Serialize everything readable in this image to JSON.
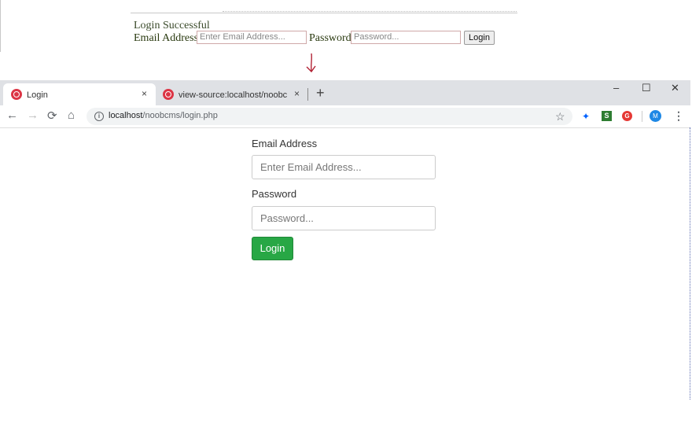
{
  "snippet": {
    "title": "Login Successful",
    "email_label": "Email Address",
    "email_placeholder": "Enter Email Address...",
    "password_label": "Password",
    "password_placeholder": "Password...",
    "login_label": "Login"
  },
  "browser": {
    "tabs": [
      {
        "title": "Login",
        "close": "×"
      },
      {
        "title": "view-source:localhost/noobcms/",
        "close": "×"
      }
    ],
    "new_tab": "+",
    "window_controls": {
      "minimize": "–",
      "maximize": "☐",
      "close": "✕"
    },
    "nav": {
      "back": "←",
      "forward": "→",
      "reload": "⟳",
      "home": "⌂"
    },
    "url_host": "localhost",
    "url_path": "/noobcms/login.php",
    "star": "☆",
    "extensions": {
      "dropbox": "✦",
      "s": "S",
      "g": "G"
    },
    "avatar": "M",
    "menu": "⋮"
  },
  "page": {
    "email_label": "Email Address",
    "email_placeholder": "Enter Email Address...",
    "password_label": "Password",
    "password_placeholder": "Password...",
    "login_label": "Login"
  },
  "colors": {
    "login_button": "#28a745",
    "tab_bar": "#dfe1e5",
    "favicon": "#dc3545",
    "arrow": "#b22234"
  }
}
